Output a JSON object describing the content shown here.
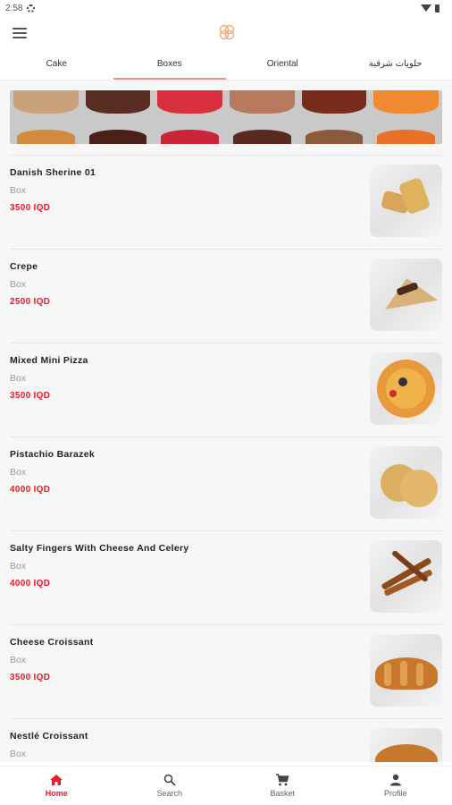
{
  "status": {
    "time": "2:58"
  },
  "tabs": [
    {
      "label": "Cake"
    },
    {
      "label": "Boxes"
    },
    {
      "label": "Oriental"
    },
    {
      "label": "حلويات شرقية"
    }
  ],
  "products": [
    {
      "name": "Danish Sherine 01",
      "type": "Box",
      "price": "3500 IQD"
    },
    {
      "name": "Crepe",
      "type": "Box",
      "price": "2500 IQD"
    },
    {
      "name": "Mixed Mini Pizza",
      "type": "Box",
      "price": "3500 IQD"
    },
    {
      "name": "Pistachio Barazek",
      "type": "Box",
      "price": "4000 IQD"
    },
    {
      "name": "Salty Fingers With Cheese And Celery",
      "type": "Box",
      "price": "4000 IQD"
    },
    {
      "name": "Cheese Croissant",
      "type": "Box",
      "price": "3500 IQD"
    },
    {
      "name": "Nestlé Croissant",
      "type": "Box",
      "price": ""
    }
  ],
  "bottom_nav": [
    {
      "label": "Home"
    },
    {
      "label": "Search"
    },
    {
      "label": "Basket"
    },
    {
      "label": "Profile"
    }
  ],
  "colors": {
    "accent": "#e8192c",
    "tab_indicator": "#f28b93",
    "logo": "#f0a070"
  }
}
